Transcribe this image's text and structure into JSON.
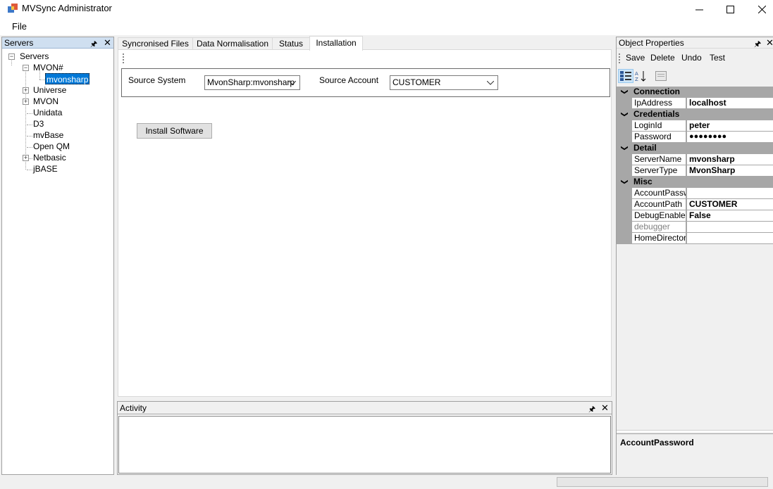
{
  "window": {
    "title": "MVSync Administrator",
    "minimize_icon": "minimize-icon",
    "maximize_icon": "maximize-icon",
    "close_icon": "close-icon"
  },
  "menu": {
    "file": "File"
  },
  "servers_panel": {
    "title": "Servers",
    "tree": {
      "root": "Servers",
      "mvon_sharp": "MVON#",
      "mvon_sharp_child": "mvonsharp",
      "universe": "Universe",
      "mvon": "MVON",
      "unidata": "Unidata",
      "d3": "D3",
      "mvbase": "mvBase",
      "openqm": "Open QM",
      "netbasic": "Netbasic",
      "jbase": "jBASE"
    }
  },
  "tabs": {
    "synced": "Syncronised Files",
    "normalisation": "Data Normalisation",
    "status": "Status",
    "installation": "Installation"
  },
  "installation": {
    "source_system_label": "Source System",
    "source_system_value": "MvonSharp:mvonsharp",
    "source_account_label": "Source Account",
    "source_account_value": "CUSTOMER",
    "install_button": "Install Software"
  },
  "activity_panel": {
    "title": "Activity"
  },
  "properties_panel": {
    "title": "Object Properties",
    "toolbar": {
      "save": "Save",
      "delete": "Delete",
      "undo": "Undo",
      "test": "Test"
    },
    "categories": {
      "connection": "Connection",
      "credentials": "Credentials",
      "detail": "Detail",
      "misc": "Misc"
    },
    "props": {
      "ipaddress_name": "IpAddress",
      "ipaddress_value": "localhost",
      "loginid_name": "LoginId",
      "loginid_value": "peter",
      "password_name": "Password",
      "password_value": "●●●●●●●●",
      "servername_name": "ServerName",
      "servername_value": "mvonsharp",
      "servertype_name": "ServerType",
      "servertype_value": "MvonSharp",
      "accountpassword_name": "AccountPassword",
      "accountpassword_value": "",
      "accountpath_name": "AccountPath",
      "accountpath_value": "CUSTOMER",
      "debugenabled_name": "DebugEnabled",
      "debugenabled_value": "False",
      "debugger_name": "debugger",
      "debugger_value": "",
      "homedirectory_name": "HomeDirectory",
      "homedirectory_value": ""
    },
    "description_title": "AccountPassword"
  },
  "colors": {
    "selection": "#0078d7",
    "panel_header": "#cfdff0",
    "category_band": "#a7a7a7"
  }
}
